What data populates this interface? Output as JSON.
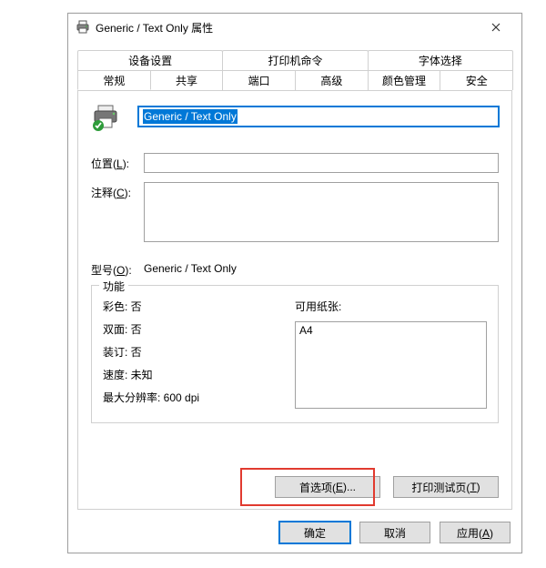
{
  "window": {
    "title": "Generic / Text Only 属性",
    "close": "×"
  },
  "tabs_row1": [
    {
      "label": "设备设置"
    },
    {
      "label": "打印机命令"
    },
    {
      "label": "字体选择"
    }
  ],
  "tabs_row2": [
    {
      "label": "常规",
      "active": true
    },
    {
      "label": "共享"
    },
    {
      "label": "端口"
    },
    {
      "label": "高级"
    },
    {
      "label": "颜色管理"
    },
    {
      "label": "安全"
    }
  ],
  "general": {
    "name_value": "Generic / Text Only",
    "location_label": "位置(L):",
    "location_value": "",
    "comment_label": "注释(C):",
    "comment_value": "",
    "model_label": "型号(O):",
    "model_value": "Generic / Text Only",
    "features_title": "功能",
    "specs": {
      "color_label": "彩色: ",
      "color_val": "否",
      "duplex_label": "双面: ",
      "duplex_val": "否",
      "staple_label": "装订: ",
      "staple_val": "否",
      "speed_label": "速度: ",
      "speed_val": "未知",
      "maxres_label": "最大分辨率: ",
      "maxres_val": "600 dpi"
    },
    "paper_label": "可用纸张:",
    "paper_items": [
      "A4"
    ],
    "prefs_btn": "首选项(E)...",
    "testpage_btn": "打印测试页(T)"
  },
  "dialog_buttons": {
    "ok": "确定",
    "cancel": "取消",
    "apply": "应用(A)"
  },
  "hotkeys": {
    "location": "L",
    "comment": "C",
    "model": "O",
    "prefs": "E",
    "testpage": "T",
    "apply": "A"
  }
}
